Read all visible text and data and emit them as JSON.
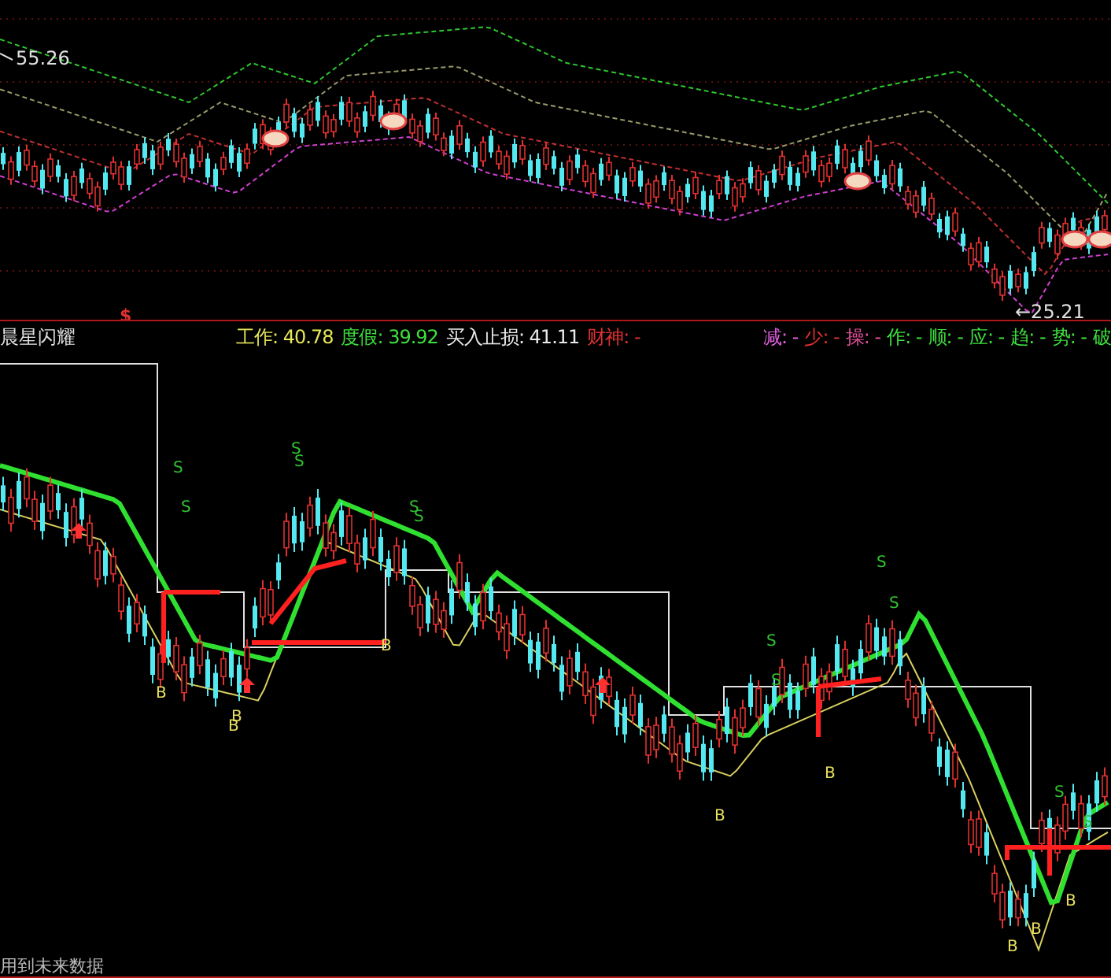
{
  "top_panel": {
    "high_label": "55.26",
    "low_label": "←25.21",
    "signal_mark": "$"
  },
  "indicator_header": {
    "title": "晨星闪耀",
    "values": [
      {
        "text": "工作: 40.78",
        "color": "#e6e65a"
      },
      {
        "text": "度假: 39.92",
        "color": "#3ee03e"
      },
      {
        "text": "买入止损: 41.11",
        "color": "#e8e8e8"
      },
      {
        "text": "财神: -",
        "color": "#e03030"
      }
    ],
    "flags": [
      {
        "text": "减: -",
        "color": "#e060e0"
      },
      {
        "text": "少: -",
        "color": "#e03030"
      },
      {
        "text": "操: -",
        "color": "#e0509a"
      },
      {
        "text": "作: -",
        "color": "#3ee03e"
      },
      {
        "text": "顺: -",
        "color": "#3ee03e"
      },
      {
        "text": "应: -",
        "color": "#3ee03e"
      },
      {
        "text": "趋: -",
        "color": "#3ee03e"
      },
      {
        "text": "势: -",
        "color": "#3ee03e"
      },
      {
        "text": "破",
        "color": "#3ee03e"
      }
    ]
  },
  "lower_panel": {
    "sell_marks": [
      "S",
      "S",
      "S",
      "S",
      "S",
      "S",
      "S",
      "S",
      "S",
      "S",
      "S",
      "S"
    ],
    "buy_marks": [
      "B",
      "B",
      "B",
      "B",
      "B",
      "B",
      "B",
      "B",
      "B"
    ]
  },
  "footer_note": "用到未来数据"
}
